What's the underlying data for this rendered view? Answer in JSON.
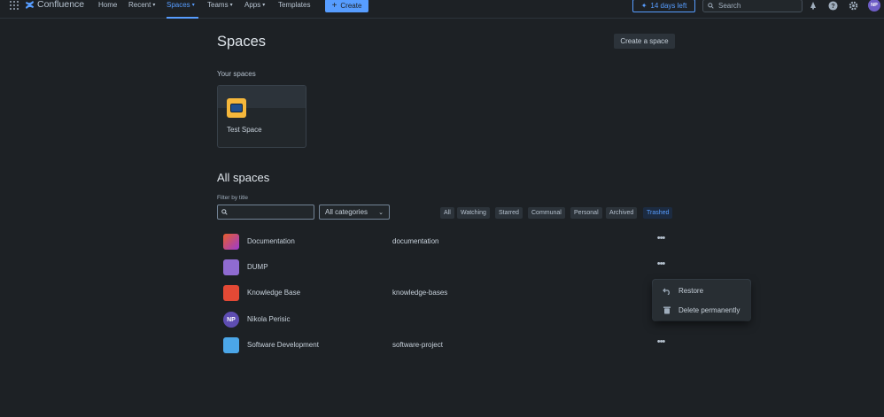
{
  "nav": {
    "brand": "Confluence",
    "home": "Home",
    "recent": "Recent",
    "spaces": "Spaces",
    "teams": "Teams",
    "apps": "Apps",
    "templates": "Templates",
    "create": "Create",
    "trial": "14 days left",
    "search_placeholder": "Search",
    "avatar_initials": "NP"
  },
  "page": {
    "title": "Spaces",
    "create_space": "Create a space",
    "your_spaces_heading": "Your spaces",
    "your_spaces": [
      {
        "name": "Test Space"
      }
    ],
    "all_spaces_heading": "All spaces",
    "filter_label": "Filter by title",
    "filter_value": "",
    "category_select": "All categories",
    "tabs": [
      "All",
      "Watching",
      "Starred",
      "Communal",
      "Personal",
      "Archived",
      "Trashed"
    ],
    "selected_tab": "Trashed"
  },
  "spaces": [
    {
      "name": "Documentation",
      "key": "documentation"
    },
    {
      "name": "DUMP",
      "key": ""
    },
    {
      "name": "Knowledge Base",
      "key": "knowledge-bases"
    },
    {
      "name": "Nikola Perisic",
      "key": "",
      "initials": "NP"
    },
    {
      "name": "Software Development",
      "key": "software-project"
    }
  ],
  "context_menu": {
    "restore": "Restore",
    "delete": "Delete permanently"
  },
  "colors": {
    "background": "#1d2125",
    "accent": "#579dff"
  }
}
